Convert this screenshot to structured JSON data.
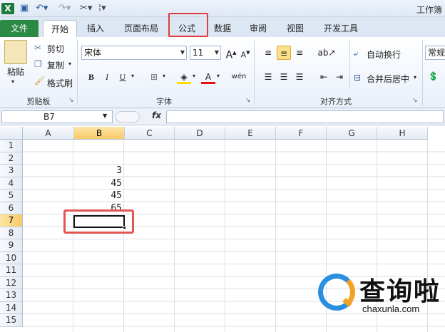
{
  "title_bar": {
    "window_title": "工作簿"
  },
  "tabs": [
    {
      "label": "文件"
    },
    {
      "label": "开始"
    },
    {
      "label": "插入"
    },
    {
      "label": "页面布局"
    },
    {
      "label": "公式"
    },
    {
      "label": "数据"
    },
    {
      "label": "审阅"
    },
    {
      "label": "视图"
    },
    {
      "label": "开发工具"
    }
  ],
  "ribbon": {
    "clipboard": {
      "paste": "粘贴",
      "cut": "剪切",
      "copy": "复制",
      "format_painter": "格式刷",
      "group": "剪贴板"
    },
    "font": {
      "font_name": "宋体",
      "font_size": "11",
      "bold": "B",
      "italic": "I",
      "underline": "U",
      "grow": "A",
      "shrink": "A",
      "font_color": "A",
      "phonetic": "wén",
      "group": "字体"
    },
    "alignment": {
      "wrap_text": "自动换行",
      "merge_center": "合并后居中",
      "group": "对齐方式"
    },
    "number": {
      "format": "常规"
    }
  },
  "formula_bar": {
    "name_box": "B7",
    "fx": "fx",
    "formula": ""
  },
  "sheet": {
    "columns": [
      "A",
      "B",
      "C",
      "D",
      "E",
      "F",
      "G",
      "H"
    ],
    "selected_column": "B",
    "rows": [
      "1",
      "2",
      "3",
      "4",
      "5",
      "6",
      "7",
      "8",
      "9",
      "10",
      "11",
      "12",
      "13",
      "14",
      "15"
    ],
    "selected_row": "7",
    "cells": [
      {
        "ref": "B3",
        "value": "3"
      },
      {
        "ref": "B4",
        "value": "45"
      },
      {
        "ref": "B5",
        "value": "45"
      },
      {
        "ref": "B6",
        "value": "65"
      }
    ]
  },
  "watermark": {
    "text": "查询啦",
    "url": "chaxunla.com"
  },
  "colors": {
    "file_tab": "#2a8a44",
    "highlight": "#e03c3c",
    "selected_header": "#f8c96a"
  }
}
